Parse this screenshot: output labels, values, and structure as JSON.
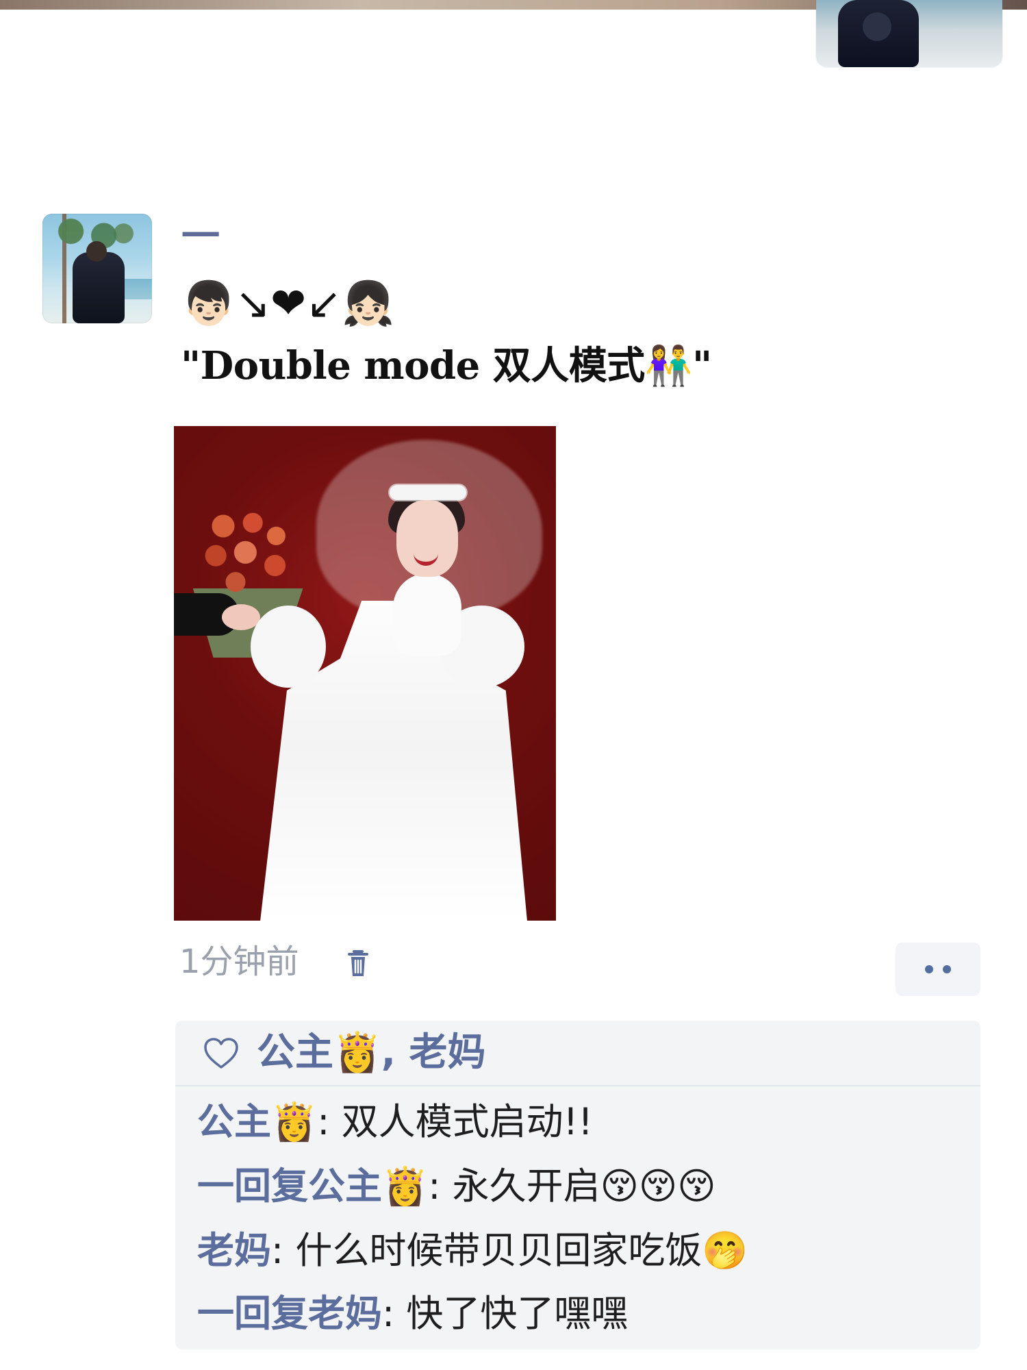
{
  "post": {
    "author": "一",
    "emoji_line": "👦🏻↘❤↙👧🏻",
    "caption": "\"Double mode 双人模式👫\"",
    "time": "1分钟前"
  },
  "likes": {
    "text": "公主👸, 老妈"
  },
  "comments": [
    {
      "prefix": "公主👸",
      "text": ": 双人模式启动!!"
    },
    {
      "prefix": "一回复",
      "name": "公主👸",
      "text": ": 永久开启😚😚😚"
    },
    {
      "prefix": "老妈",
      "text": ": 什么时候带贝贝回家吃饭🤭"
    },
    {
      "prefix": "一回复",
      "name": "老妈",
      "text": ": 快了快了嘿嘿"
    }
  ],
  "icons": {
    "heart": "heart-icon",
    "trash": "trash-icon",
    "more": "more-icon"
  },
  "colors": {
    "name": "#5b6d9c",
    "meta": "#9aa1ac",
    "photo_bg": "#6d0e0e"
  }
}
